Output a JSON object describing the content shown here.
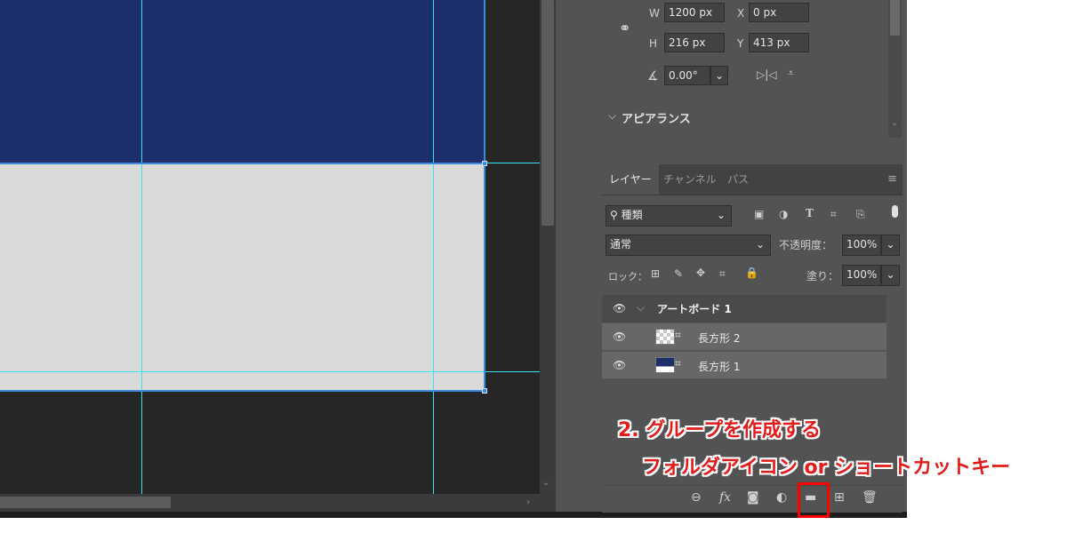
{
  "properties": {
    "w_label": "W",
    "w_value": "1200 px",
    "x_label": "X",
    "x_value": "0 px",
    "h_label": "H",
    "h_value": "216 px",
    "y_label": "Y",
    "y_value": "413 px",
    "angle_value": "0.00°",
    "appearance_label": "アピアランス"
  },
  "layers_panel": {
    "tabs": [
      "レイヤー",
      "チャンネル",
      "パス"
    ],
    "filter_kind": "種類",
    "blend_mode": "通常",
    "opacity_label": "不透明度：",
    "opacity_value": "100%",
    "lock_label": "ロック：",
    "fill_label": "塗り：",
    "fill_value": "100%",
    "artboard_name": "アートボード 1",
    "layers": [
      {
        "name": "長方形 2"
      },
      {
        "name": "長方形 1"
      }
    ]
  },
  "annotation": {
    "step": "2. グループを作成する",
    "hint": "フォルダアイコン or ショートカットキー"
  },
  "colors": {
    "artboard_top": "#1c2f6b",
    "artboard_bottom": "#d9d9d9",
    "guide": "#36e4ef",
    "annotation": "#e21b1b"
  },
  "footer_icons": [
    "link-icon",
    "fx-icon",
    "mask-icon",
    "adjustment-icon",
    "folder-icon",
    "new-layer-icon",
    "trash-icon"
  ]
}
